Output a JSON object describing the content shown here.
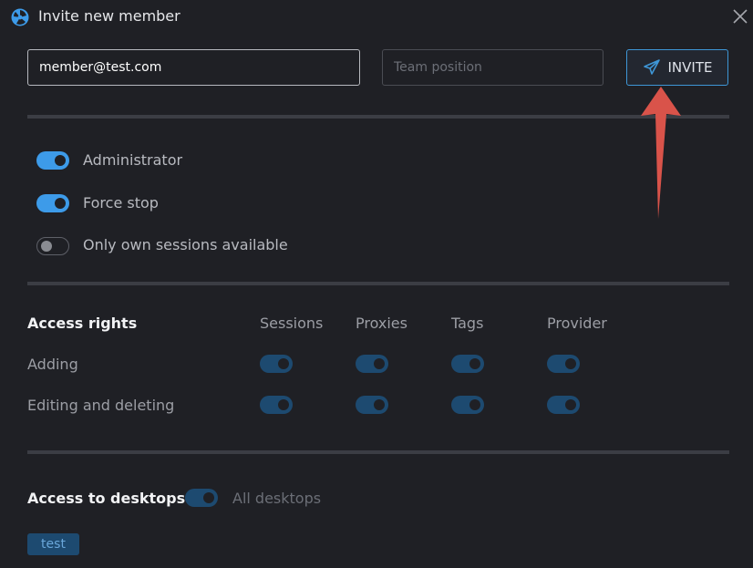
{
  "window": {
    "title": "Invite new member",
    "logo_icon": "app-logo-icon",
    "close_icon": "close-icon"
  },
  "form": {
    "email_value": "member@test.com",
    "position_placeholder": "Team position",
    "invite_label": "INVITE",
    "invite_icon": "paper-plane-icon"
  },
  "options": [
    {
      "label": "Administrator",
      "enabled": true
    },
    {
      "label": "Force stop",
      "enabled": true
    },
    {
      "label": "Only own sessions available",
      "enabled": false
    }
  ],
  "access_rights": {
    "heading": "Access rights",
    "columns": [
      "Sessions",
      "Proxies",
      "Tags",
      "Provider"
    ],
    "rows": [
      {
        "label": "Adding",
        "values": [
          true,
          true,
          true,
          true
        ]
      },
      {
        "label": "Editing and deleting",
        "values": [
          true,
          true,
          true,
          true
        ]
      }
    ]
  },
  "desktops": {
    "heading": "Access to desktops",
    "all_label": "All desktops",
    "all_enabled": true,
    "tags": [
      "test"
    ]
  },
  "colors": {
    "accent": "#3d9be9",
    "background": "#1f2025",
    "arrow": "#d9534a"
  }
}
